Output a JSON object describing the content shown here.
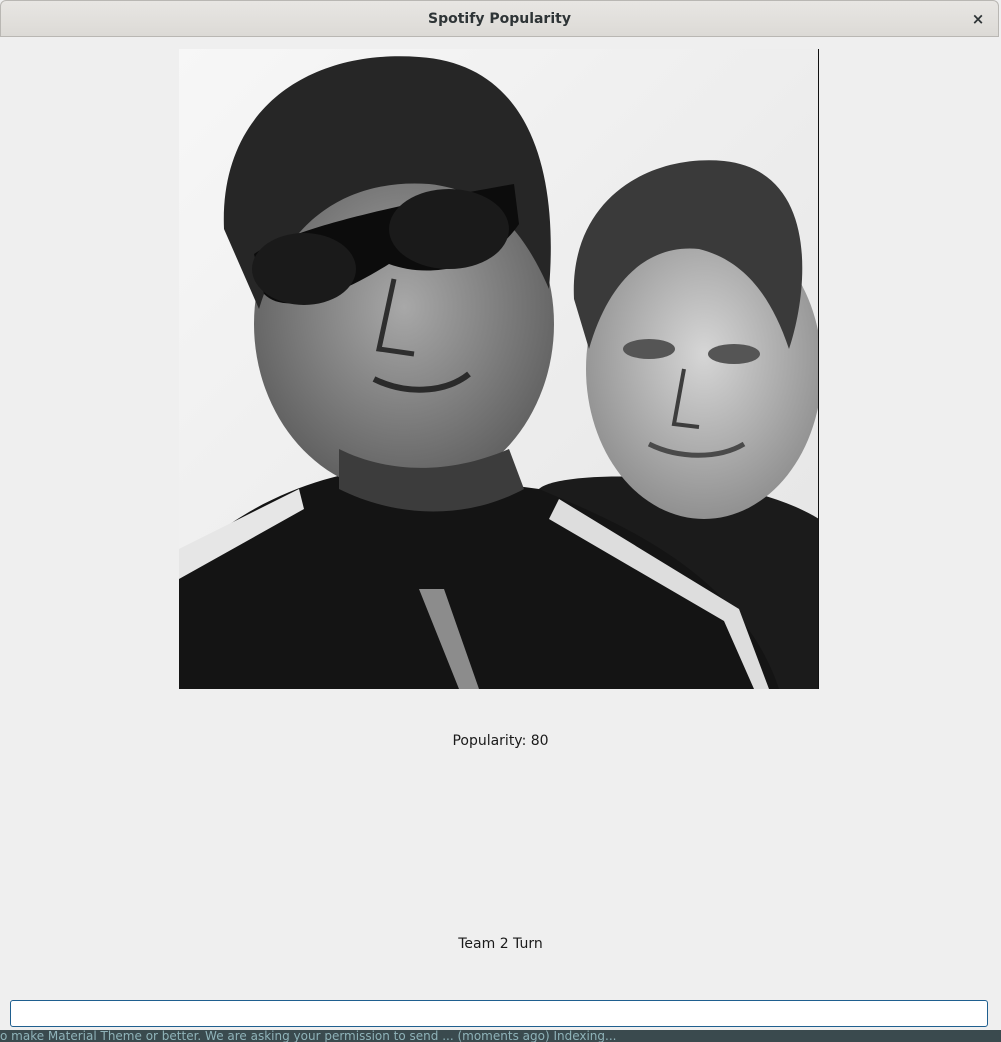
{
  "window": {
    "title": "Spotify Popularity",
    "close_glyph": "×"
  },
  "artist": {
    "image_alt": "Black and white photo of two men in dark track jackets, one wearing sunglasses"
  },
  "popularity": {
    "text": "Popularity: 80",
    "value": 80
  },
  "turn": {
    "text": "Team 2 Turn"
  },
  "guess_input": {
    "value": "",
    "placeholder": ""
  },
  "background_text": "o make Material Theme or better. We are asking your permission to send ... (moments ago)   Indexing..."
}
